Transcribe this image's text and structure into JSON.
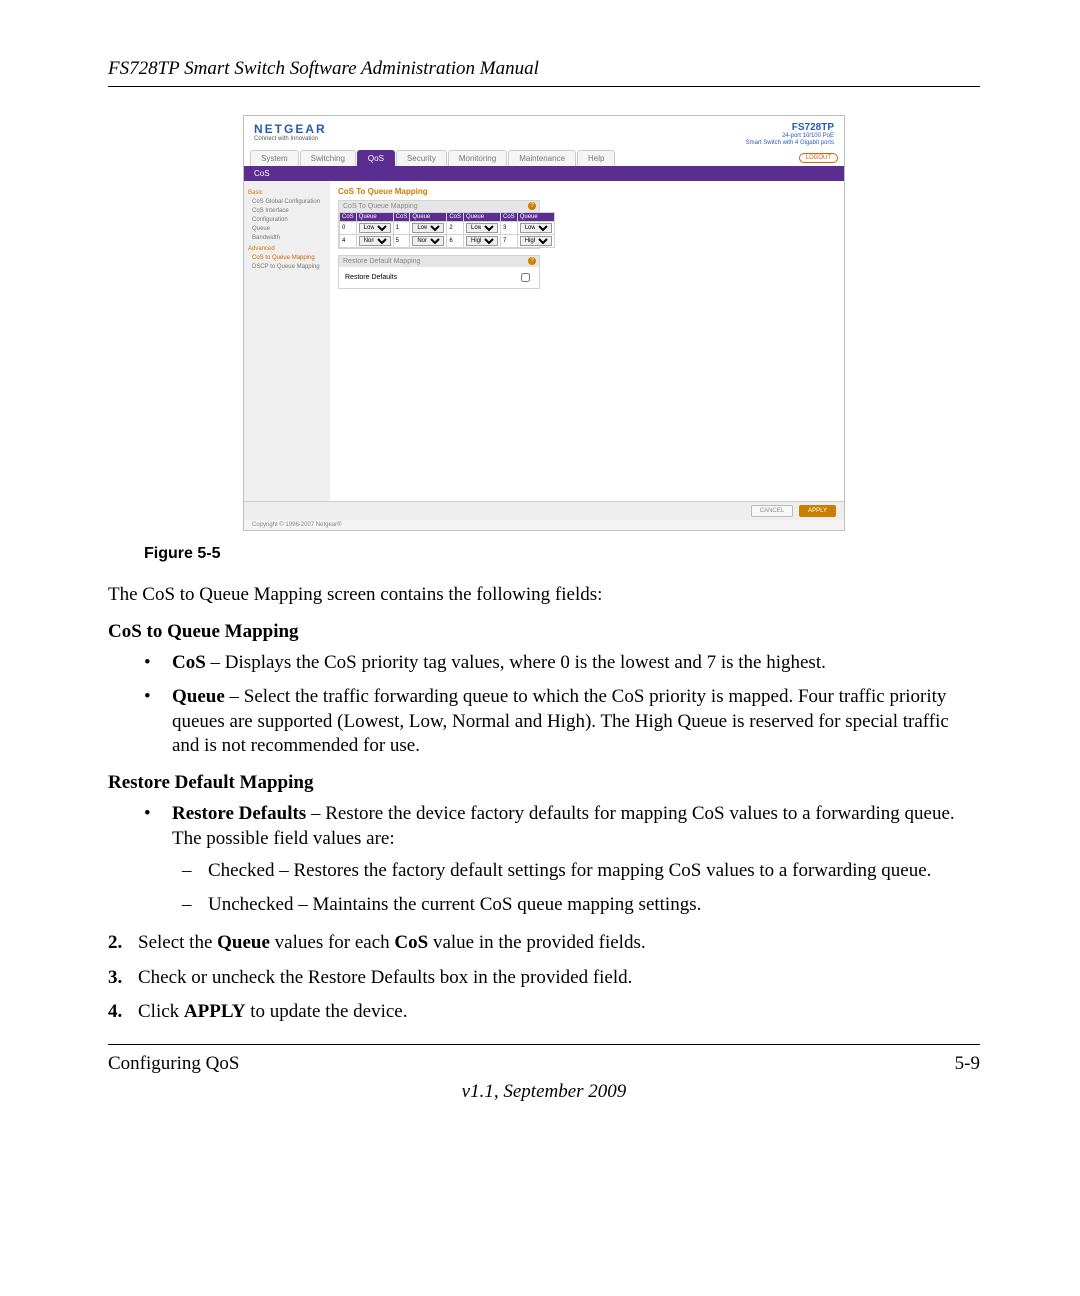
{
  "doc": {
    "header": "FS728TP Smart Switch Software Administration Manual",
    "figure_caption": "Figure 5-5",
    "intro": "The CoS to Queue Mapping screen contains the following fields:",
    "section1_title": "CoS to Queue Mapping",
    "bullets1": {
      "cos_label": "CoS",
      "cos_text": " – Displays the CoS priority tag values, where 0 is the lowest and 7 is the highest.",
      "queue_label": "Queue",
      "queue_text": " – Select the traffic forwarding queue to which the CoS priority is mapped. Four traffic priority queues are supported (Lowest, Low, Normal and High). The High Queue is reserved for special traffic and is not recommended for use."
    },
    "section2_title": "Restore Default Mapping",
    "restore_label": "Restore Defaults",
    "restore_text": " – Restore the device factory defaults for mapping CoS values to a forwarding queue. The possible field values are:",
    "restore_checked": "Checked – Restores the factory default settings for mapping CoS values to a forwarding queue.",
    "restore_unchecked": "Unchecked – Maintains the current CoS queue mapping settings.",
    "step2_pre": "Select the ",
    "step2_q": "Queue",
    "step2_mid": " values for each ",
    "step2_c": "CoS",
    "step2_post": " value in the provided fields.",
    "step3": "Check or uncheck the Restore Defaults box in the provided field.",
    "step4_pre": "Click ",
    "step4_apply": "APPLY",
    "step4_post": " to update the device.",
    "footer_left": "Configuring QoS",
    "footer_right": "5-9",
    "version": "v1.1, September 2009",
    "step_nums": {
      "s2": "2.",
      "s3": "3.",
      "s4": "4."
    }
  },
  "ui": {
    "brand": "NETGEAR",
    "brand_tag": "Connect with Innovation",
    "model": "FS728TP",
    "model_line1": "24-port 10/100 PoE",
    "model_line2": "Smart Switch with 4 Gigabit ports",
    "logout": "LOGOUT",
    "tabs": [
      "System",
      "Switching",
      "QoS",
      "Security",
      "Monitoring",
      "Maintenance",
      "Help"
    ],
    "active_tab": "QoS",
    "subnav": "CoS",
    "sidebar": {
      "group_basic": "Basic",
      "items_basic": [
        "CoS Global Configuration",
        "CoS Interface Configuration",
        "Queue",
        "Bandwidth"
      ],
      "group_adv": "Advanced",
      "item_adv_active": "CoS to Queue Mapping",
      "item_adv_other": "DSCP to Queue Mapping"
    },
    "panel_main_title": "CoS To Queue Mapping",
    "panel1_head": "CoS To Queue Mapping",
    "th_cos": "CoS",
    "th_queue": "Queue",
    "rows": [
      {
        "c0": "0",
        "q0": "Low",
        "c1": "1",
        "q1": "Lowest",
        "c2": "2",
        "q2": "Lowest",
        "c3": "3",
        "q3": "Low"
      },
      {
        "c0": "4",
        "q0": "Normal",
        "c1": "5",
        "q1": "Normal",
        "c2": "6",
        "q2": "High",
        "c3": "7",
        "q3": "High"
      }
    ],
    "panel2_head": "Restore Default Mapping",
    "restore_label": "Restore Defaults",
    "btn_cancel": "CANCEL",
    "btn_apply": "APPLY",
    "copyright": "Copyright © 1996-2007 Netgear®"
  }
}
